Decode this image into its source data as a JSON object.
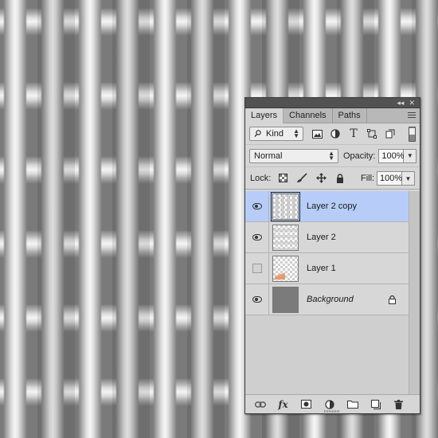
{
  "panel": {
    "tabs": [
      "Layers",
      "Channels",
      "Paths"
    ],
    "active_tab": "Layers",
    "collapse_glyph": "◂◂",
    "close_glyph": "✕"
  },
  "filter": {
    "kind_label": "Kind",
    "icons": [
      "image-filter-icon",
      "adjustment-filter-icon",
      "type-filter-icon",
      "shape-filter-icon",
      "smart-object-filter-icon"
    ]
  },
  "blend": {
    "mode": "Normal",
    "opacity_label": "Opacity:",
    "opacity_value": "100%"
  },
  "lock": {
    "label": "Lock:",
    "fill_label": "Fill:",
    "fill_value": "100%"
  },
  "layers": [
    {
      "name": "Layer 2 copy",
      "visible": true,
      "selected": true,
      "thumbnail": "vertical-stripes"
    },
    {
      "name": "Layer 2",
      "visible": true,
      "selected": false,
      "thumbnail": "horizontal-stripes"
    },
    {
      "name": "Layer 1",
      "visible": false,
      "selected": false,
      "thumbnail": "transparent-with-orange"
    },
    {
      "name": "Background",
      "visible": true,
      "selected": false,
      "thumbnail": "gray-fill",
      "locked": true
    }
  ],
  "bottom_toolbar": {
    "fx_label": "fx"
  },
  "colors": {
    "selection": "#b7cdf8",
    "panel_bg": "#d6d6d6",
    "titlebar": "#525252"
  }
}
